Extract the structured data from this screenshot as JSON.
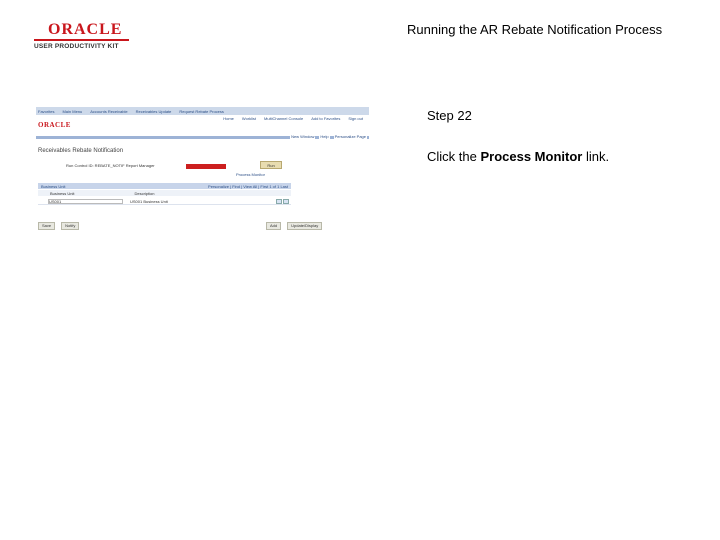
{
  "header": {
    "logo_brand": "ORACLE",
    "logo_subtitle": "USER PRODUCTIVITY KIT",
    "document_title": "Running the AR Rebate Notification Process"
  },
  "screenshot": {
    "topnav": [
      "Favorites",
      "Main Menu",
      "Accounts Receivable",
      "Receivables Update",
      "Request Rebate Process"
    ],
    "brand": "ORACLE",
    "header_links": [
      "Home",
      "Worklist",
      "MultiChannel Console",
      "Add to Favorites",
      "Sign out"
    ],
    "page_links": [
      "New Window",
      "Help",
      "Personalize Page"
    ],
    "page_title": "Receivables Rebate Notification",
    "run_control": "Run Control ID: REBATE_NOTIF   Report Manager",
    "run_button": "Run",
    "process_monitor_link": "Process Monitor",
    "grid": {
      "title": "Business Unit",
      "nav": "Personalize | Find | View All | First 1 of 1 Last",
      "columns": [
        "Business Unit",
        "Description"
      ],
      "row": {
        "business_unit": "US001",
        "description": "US001 Business Unit"
      }
    },
    "bottom_left_buttons": [
      "Save",
      "Notify"
    ],
    "bottom_right_buttons": [
      "Add",
      "Update/Display"
    ]
  },
  "instructions": {
    "step": "Step 22",
    "prefix": "Click the ",
    "target": "Process Monitor",
    "suffix": " link."
  }
}
